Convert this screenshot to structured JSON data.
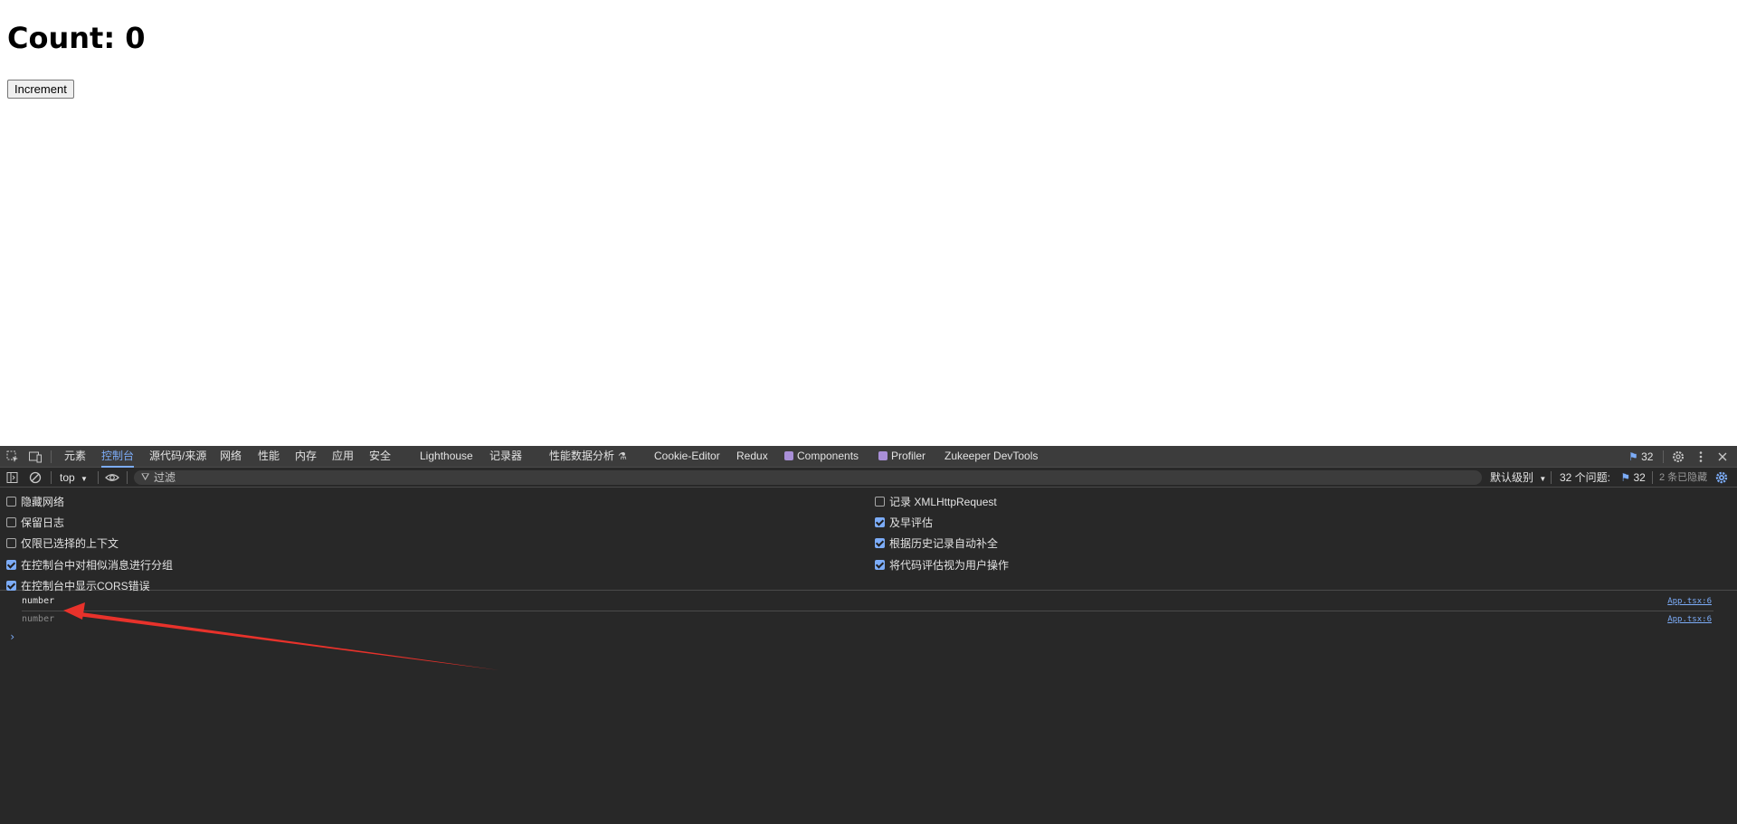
{
  "app": {
    "heading": "Count: 0",
    "increment_label": "Increment"
  },
  "devtools": {
    "tabs": [
      {
        "label": "元素",
        "active": false
      },
      {
        "label": "控制台",
        "active": true
      },
      {
        "label": "源代码/来源",
        "active": false
      },
      {
        "label": "网络",
        "active": false
      },
      {
        "label": "性能",
        "active": false
      },
      {
        "label": "内存",
        "active": false
      },
      {
        "label": "应用",
        "active": false
      },
      {
        "label": "安全",
        "active": false
      },
      {
        "label": "Lighthouse",
        "active": false
      },
      {
        "label": "记录器",
        "active": false
      },
      {
        "label": "性能数据分析",
        "active": false
      },
      {
        "label": "Cookie-Editor",
        "active": false
      },
      {
        "label": "Redux",
        "active": false
      },
      {
        "label": "Components",
        "active": false
      },
      {
        "label": "Profiler",
        "active": false
      },
      {
        "label": "Zukeeper DevTools",
        "active": false
      }
    ],
    "issues_badge": "32",
    "context": "top",
    "filter_placeholder": "过滤",
    "level": "默认级别",
    "issues_label": "32 个问题:",
    "issues_count": "32",
    "hidden_label": "2 条已隐藏",
    "settings_left": [
      {
        "label": "隐藏网络",
        "checked": false
      },
      {
        "label": "保留日志",
        "checked": false
      },
      {
        "label": "仅限已选择的上下文",
        "checked": false
      },
      {
        "label": "在控制台中对相似消息进行分组",
        "checked": true
      },
      {
        "label": "在控制台中显示CORS错误",
        "checked": true
      }
    ],
    "settings_right": [
      {
        "label": "记录 XMLHttpRequest",
        "checked": false
      },
      {
        "label": "及早评估",
        "checked": true
      },
      {
        "label": "根据历史记录自动补全",
        "checked": true
      },
      {
        "label": "将代码评估视为用户操作",
        "checked": true
      }
    ],
    "messages": [
      {
        "text": "number",
        "source": "App.tsx:6",
        "dim": false
      },
      {
        "text": "number",
        "source": "App.tsx:6",
        "dim": true
      }
    ],
    "prompt_symbol": "›"
  },
  "colors": {
    "accent": "#7cacf8",
    "devtools_bg": "#282828",
    "annotation_arrow": "#e8322b"
  }
}
